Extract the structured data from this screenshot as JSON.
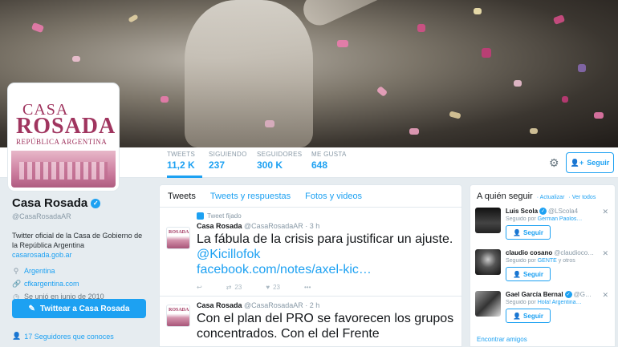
{
  "profile": {
    "name": "Casa Rosada",
    "handle": "@CasaRosadaAR",
    "bio": "Twitter oficial de la Casa de Gobierno de la República Argentina",
    "website": "casarosada.gob.ar",
    "location": "Argentina",
    "link": "cfkargentina.com",
    "joined": "Se unió en junio de 2010",
    "tweet_to_label": "Twittear a Casa Rosada",
    "followers_you_know": "17 Seguidores que conoces",
    "avatar_line1": "CASA",
    "avatar_line2": "ROSADA",
    "avatar_line3": "REPÚBLICA ARGENTINA"
  },
  "stats": [
    {
      "label": "TWEETS",
      "value": "11,2 K"
    },
    {
      "label": "SIGUIENDO",
      "value": "237"
    },
    {
      "label": "SEGUIDORES",
      "value": "300 K"
    },
    {
      "label": "ME GUSTA",
      "value": "648"
    }
  ],
  "header": {
    "follow_label": "Seguir"
  },
  "tabs": [
    {
      "label": "Tweets"
    },
    {
      "label": "Tweets y respuestas"
    },
    {
      "label": "Fotos y videos"
    }
  ],
  "tweets": [
    {
      "pinned_label": "Tweet fijado",
      "name": "Casa Rosada",
      "handle": "@CasaRosadaAR",
      "time": "· 3 h",
      "text": "La fábula de la crisis para justificar un ajuste. ",
      "mention": "@Kicillofok",
      "link": "facebook.com/notes/axel-kic…",
      "retweets": "23",
      "likes": "23"
    },
    {
      "name": "Casa Rosada",
      "handle": "@CasaRosadaAR",
      "time": "· 2 h",
      "text": "Con el plan del PRO se favorecen los grupos concentrados. Con el del Frente"
    }
  ],
  "who_to_follow": {
    "title": "A quién seguir",
    "refresh": "· Actualizar",
    "view_all": "· Ver todos",
    "follow_label": "Seguir",
    "more_label": "Encontrar amigos",
    "items": [
      {
        "name": "Luis Scola",
        "handle": "@LScola4",
        "followed_prefix": "Seguido por ",
        "followed_by": "German Paolos…"
      },
      {
        "name": "claudio cosano",
        "handle": "@claudioco…",
        "followed_prefix": "Seguido por ",
        "followed_by": "GENTE",
        "followed_suffix": " y otros"
      },
      {
        "name": "Gael García Bernal",
        "handle": "@G…",
        "followed_prefix": "Seguido por ",
        "followed_by": "Hola! Argentina…"
      }
    ]
  },
  "colors": {
    "accent": "#1da1f2",
    "brand": "#a0355f"
  }
}
